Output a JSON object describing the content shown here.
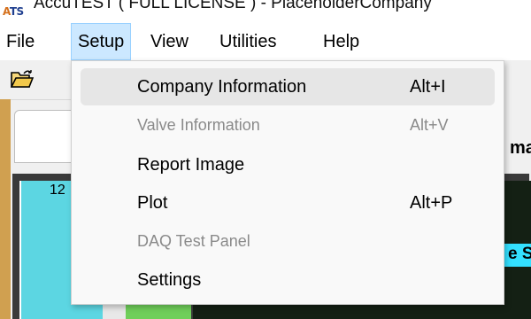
{
  "window": {
    "title": "AccuTEST ( FULL LICENSE )  - PlaceholderCompany",
    "logo": "ATS"
  },
  "menubar": {
    "items": [
      {
        "label": "File"
      },
      {
        "label": "Setup"
      },
      {
        "label": "View"
      },
      {
        "label": "Utilities"
      },
      {
        "label": "Help"
      }
    ],
    "active": "Setup"
  },
  "toolbar": {
    "open_icon": "open-folder-icon"
  },
  "setup_menu": {
    "items": [
      {
        "label": "Company Information",
        "shortcut": "Alt+I",
        "enabled": true
      },
      {
        "label": "Valve Information",
        "shortcut": "Alt+V",
        "enabled": false
      },
      {
        "label": "Report Image",
        "shortcut": "",
        "enabled": true
      },
      {
        "label": "Plot",
        "shortcut": "Alt+P",
        "enabled": true
      },
      {
        "label": "DAQ Test Panel",
        "shortcut": "",
        "enabled": false
      },
      {
        "label": "Settings",
        "shortcut": "",
        "enabled": true
      }
    ]
  },
  "background": {
    "gauge_value": "12",
    "header_fragment": "ma",
    "badge_fragment": "e S"
  },
  "colors": {
    "menu_active_bg": "#cce8ff",
    "menu_hover_bg": "#e6e6e6",
    "disabled_text": "#8a8a8a",
    "gauge_cyan": "#5cd6e2",
    "gauge_green": "#6fcf5a",
    "panel_dark": "#142014",
    "badge_cyan": "#33e0ff"
  }
}
